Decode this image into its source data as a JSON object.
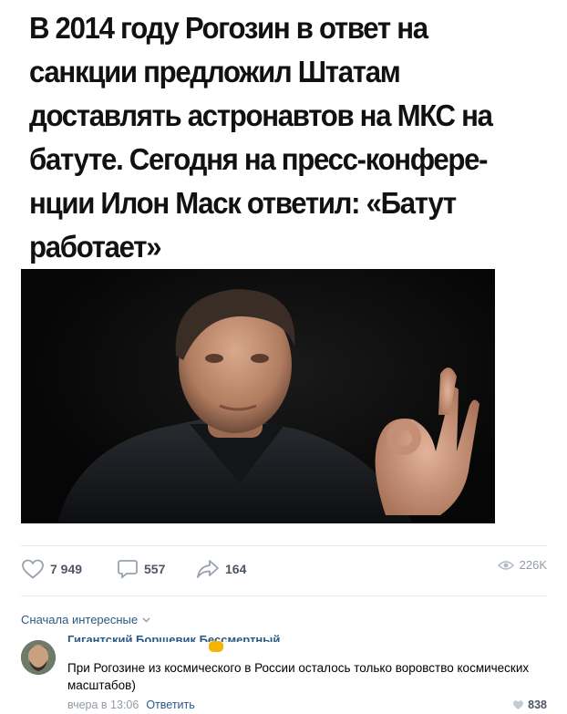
{
  "post": {
    "headline": "В 2014 году Рогозин в ответ на санкции предложил Штатам доставлять астронавтов на МКС на батуте. Сегодня на пресс-конфере-нции Илон Маск ответил: «Батут работает»",
    "headline_lines": [
      "В 2014 году Рогозин в ответ на",
      "санкции предложил Штатам",
      "доставлять астронавтов на МКС на",
      "батуте. Сегодня на пресс-конфере-",
      "нции Илон Маск ответил: «Батут",
      "работает»"
    ],
    "image_subject": "man-making-ok-gesture"
  },
  "actions": {
    "likes": "7 949",
    "comments": "557",
    "shares": "164",
    "views": "226K"
  },
  "comments_section": {
    "sort_label": "Сначала интересные",
    "comment": {
      "author": "Гигантский Борщевик Бессмертный",
      "text": "При Рогозине из космического в России осталось только воровство космических масштабов)",
      "time": "вчера в 13:06",
      "reply_label": "Ответить",
      "likes": "838"
    }
  },
  "colors": {
    "link": "#2a5885",
    "muted": "#939ba6",
    "icon": "#99a2ad",
    "divider": "#e7e8ec"
  }
}
